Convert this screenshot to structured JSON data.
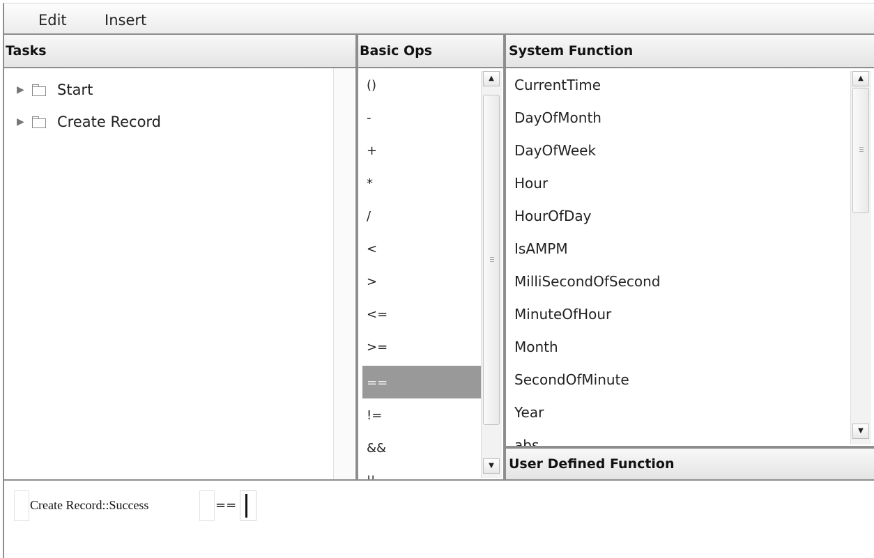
{
  "menu": {
    "edit": "Edit",
    "insert": "Insert"
  },
  "tasks": {
    "header": "Tasks",
    "items": [
      "Start",
      "Create Record"
    ]
  },
  "basic_ops": {
    "header": "Basic Ops",
    "items": [
      "()",
      "-",
      "+",
      "*",
      "/",
      "<",
      ">",
      "<=",
      ">=",
      "==",
      "!=",
      "&&",
      "||"
    ],
    "selected": "=="
  },
  "system_function": {
    "header": "System Function",
    "items": [
      "CurrentTime",
      "DayOfMonth",
      "DayOfWeek",
      "Hour",
      "HourOfDay",
      "IsAMPM",
      "MilliSecondOfSecond",
      "MinuteOfHour",
      "Month",
      "SecondOfMinute",
      "Year",
      "abs"
    ]
  },
  "user_defined_function": {
    "header": "User Defined Function"
  },
  "expression": {
    "tokens": [
      "Create Record::Success",
      "=="
    ]
  },
  "icons": {
    "tree_expand": "triangle-right-icon",
    "folder": "folder-icon",
    "scroll_up": "up-arrow-icon",
    "scroll_down": "down-arrow-icon"
  }
}
